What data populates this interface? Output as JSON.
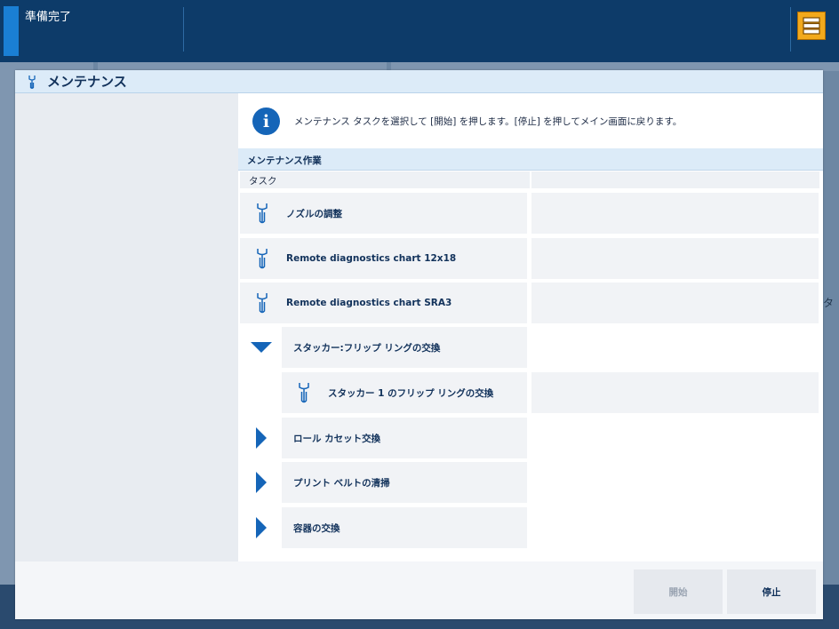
{
  "status": {
    "text": "準備完了"
  },
  "topbar": {
    "menu_icon": "server-stack-icon"
  },
  "underlay": {
    "partial_text": "タ"
  },
  "dialog": {
    "title": "メンテナンス",
    "title_icon": "wrench-icon",
    "info_text": "メンテナンス タスクを選択して [開始] を押します。[停止] を押してメイン画面に戻ります。",
    "section_title": "メンテナンス作業",
    "column_task": "タスク",
    "tasks": [
      {
        "label": "ノズルの調整",
        "type": "task"
      },
      {
        "label": "Remote diagnostics chart 12x18",
        "type": "task"
      },
      {
        "label": "Remote diagnostics chart SRA3",
        "type": "task"
      },
      {
        "label": "スタッカー:フリップ リングの交換",
        "type": "group-expanded"
      },
      {
        "label": "スタッカー 1 のフリップ リングの交換",
        "type": "subtask"
      },
      {
        "label": "ロール カセット交換",
        "type": "group-collapsed"
      },
      {
        "label": "プリント ベルトの清掃",
        "type": "group-collapsed"
      },
      {
        "label": "容器の交換",
        "type": "group-collapsed"
      }
    ],
    "buttons": {
      "start": "開始",
      "stop": "停止"
    }
  },
  "colors": {
    "accent": "#1565b8",
    "topbar": "#0d3b69",
    "menu_button": "#f2a91c"
  }
}
